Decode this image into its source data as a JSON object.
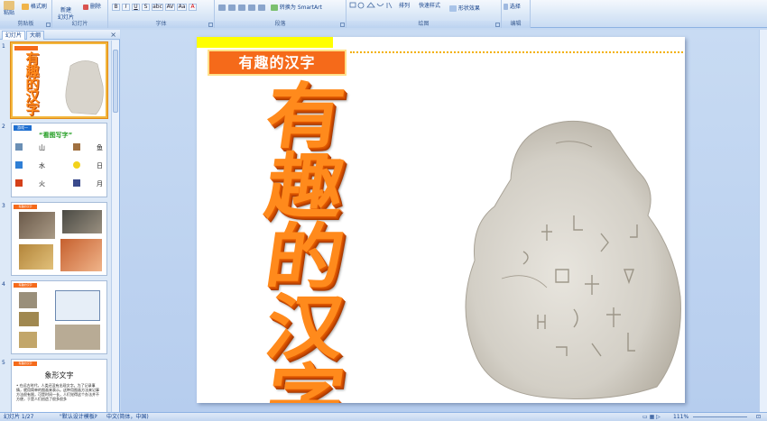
{
  "ribbon": {
    "paste": "粘贴",
    "format_painter": "格式刷",
    "new_slide": "新建\n幻灯片",
    "delete": "删除",
    "smartart": "转换为 SmartArt",
    "arrange": "排列",
    "quick_styles": "快速样式",
    "shape_effects": "形状效果",
    "select": "选择",
    "groups": {
      "clipboard": "剪贴板",
      "slides": "幻灯片",
      "font": "字体",
      "paragraph": "段落",
      "drawing": "绘图",
      "editing": "编辑"
    },
    "format_buttons": [
      "B",
      "I",
      "U",
      "S",
      "abc",
      "AV",
      "Aa",
      "A"
    ]
  },
  "panel": {
    "tab_slides": "幻灯片",
    "tab_outline": "大纲",
    "close": "×",
    "thumbs": [
      {
        "num": "1",
        "label": "有趣的汉字",
        "chars": [
          "有",
          "趣",
          "的",
          "汉",
          "字"
        ]
      },
      {
        "num": "2",
        "label": "看图写字",
        "header": "游戏一",
        "rows": [
          [
            "山",
            "鱼"
          ],
          [
            "水",
            "日"
          ],
          [
            "火",
            "月"
          ]
        ]
      },
      {
        "num": "3",
        "label": "有趣的汉字"
      },
      {
        "num": "4",
        "label": "有趣的汉字"
      },
      {
        "num": "5",
        "label": "有趣的汉字",
        "title": "象形文字",
        "body": "• 在远古时代，人类还没有出现文字。为了记录事情，就用简单的图画来表示。这种用图画方法来记事方法很有限，可是时间一长，人们觉得这个办法并不方便，于是人们创造了很多很多"
      }
    ]
  },
  "slide": {
    "title": "有趣的汉字",
    "big_chars": [
      "有",
      "趣",
      "的",
      "汉",
      "字"
    ]
  },
  "status": {
    "slide_info": "幻灯片 1/27",
    "theme": "\"默认设计模板\"",
    "language": "中文(简体，中国)",
    "zoom": "111%"
  },
  "colors": {
    "title_bg": "#f56a1a",
    "big_text": "#ff8a1c",
    "accent_yellow": "#ffff00"
  }
}
